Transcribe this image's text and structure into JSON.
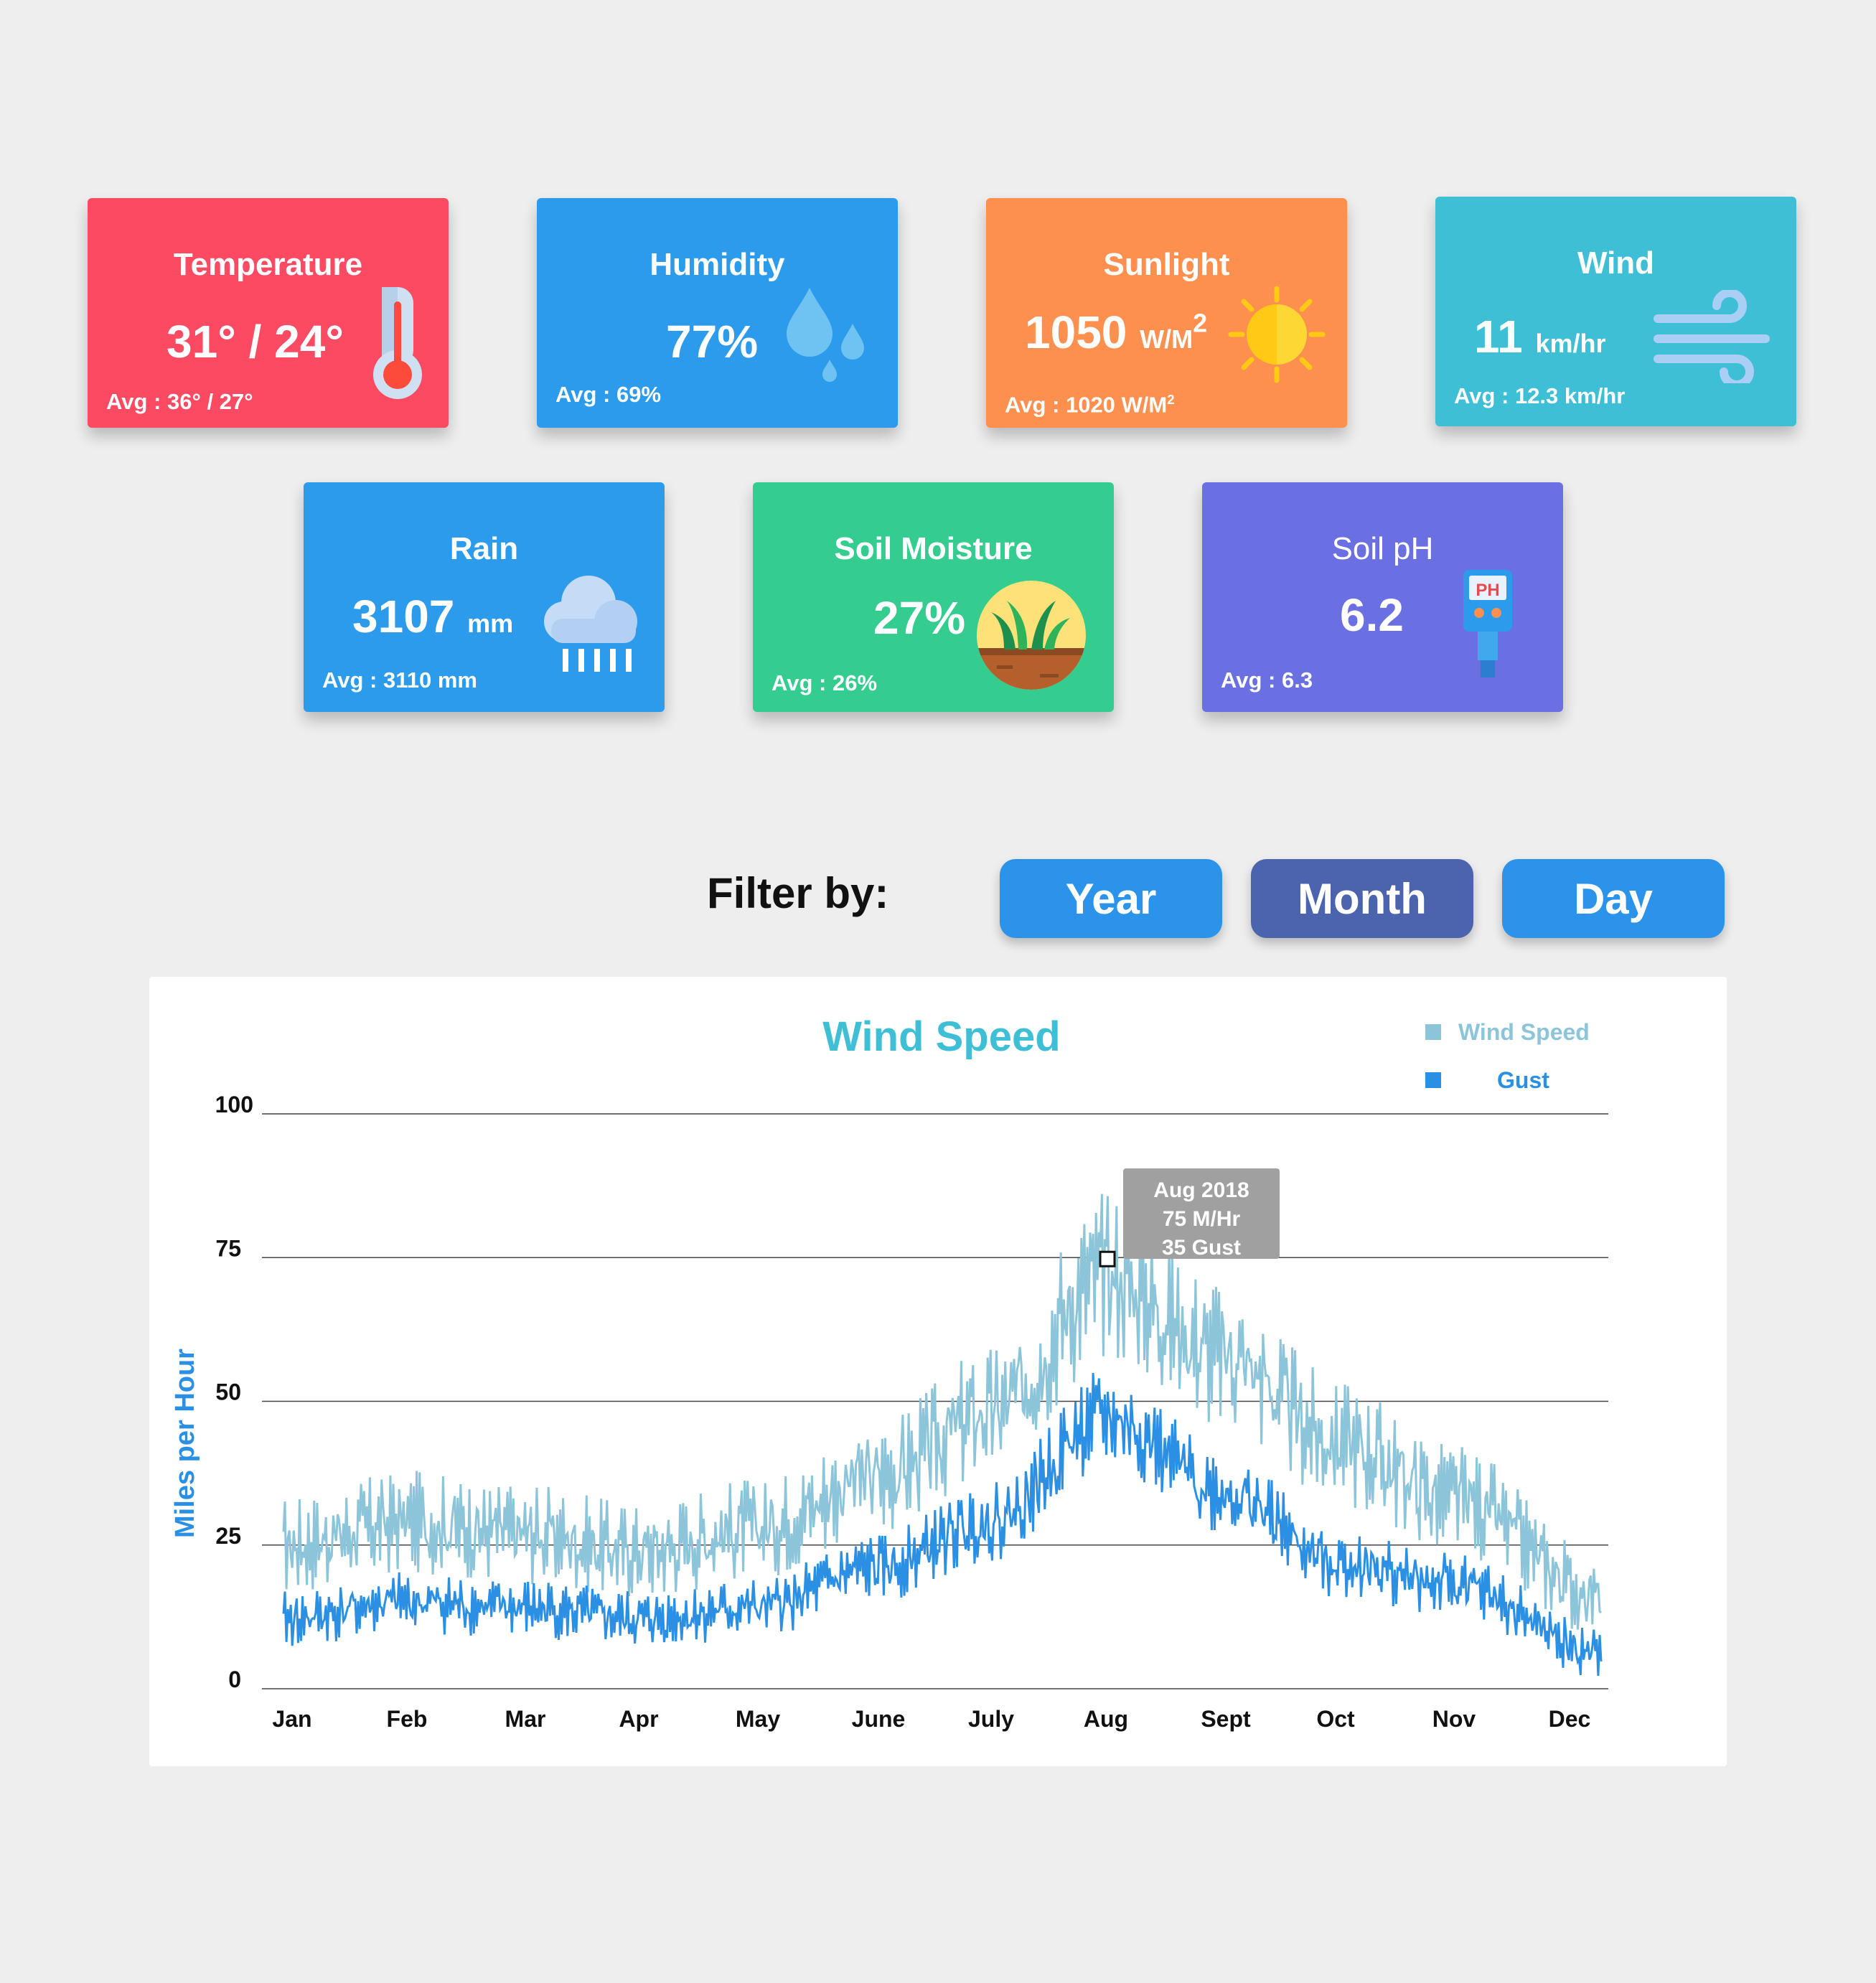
{
  "colors": {
    "temperature": "#fc4a63",
    "humidity": "#2c9bec",
    "sunlight": "#fd904f",
    "wind": "#3fbfd6",
    "rain": "#2c9bec",
    "soil_moisture": "#35cc8f",
    "soil_ph": "#6a70e2",
    "wind_speed": "#8cc5d9",
    "gust": "#2b8fe3",
    "btn_active": "#4c63ad",
    "btn": "#2c93ea"
  },
  "cards": {
    "temperature": {
      "title": "Temperature",
      "value": "31° / 24°",
      "avg": "Avg : 36° / 27°",
      "icon": "thermometer-icon"
    },
    "humidity": {
      "title": "Humidity",
      "value": "77%",
      "avg": "Avg : 69%",
      "icon": "water-drops-icon"
    },
    "sunlight": {
      "title": "Sunlight",
      "value": "1050",
      "unit": "W/M",
      "sup": "2",
      "avg_prefix": "Avg :  1020 W/M",
      "avg_sup": "2",
      "icon": "sun-icon"
    },
    "wind": {
      "title": "Wind",
      "value": "11",
      "unit": "km/hr",
      "avg": "Avg : 12.3 km/hr",
      "icon": "wind-icon"
    },
    "rain": {
      "title": "Rain",
      "value": "3107",
      "unit": "mm",
      "avg": "Avg : 3110 mm",
      "icon": "rain-cloud-icon"
    },
    "soil_moisture": {
      "title": "Soil Moisture",
      "value": "27%",
      "avg": "Avg : 26%",
      "icon": "grass-soil-icon"
    },
    "soil_ph": {
      "title": "Soil pH",
      "value": "6.2",
      "avg": "Avg : 6.3",
      "icon": "ph-meter-icon",
      "icon_text": "PH"
    }
  },
  "filter": {
    "label": "Filter by:",
    "buttons": [
      {
        "label": "Year",
        "active": false
      },
      {
        "label": "Month",
        "active": true
      },
      {
        "label": "Day",
        "active": false
      }
    ]
  },
  "chart_data": {
    "type": "line",
    "title": "Wind Speed",
    "xlabel": "",
    "ylabel": "Miles per Hour",
    "ylim": [
      0,
      100
    ],
    "yticks": [
      0,
      25,
      50,
      75,
      100
    ],
    "categories": [
      "Jan",
      "Feb",
      "Mar",
      "Apr",
      "May",
      "June",
      "July",
      "Aug",
      "Sept",
      "Oct",
      "Nov",
      "Dec"
    ],
    "grid": true,
    "legend_position": "top-right",
    "series": [
      {
        "name": "Wind Speed",
        "values": [
          25,
          29,
          27,
          24,
          28,
          37,
          48,
          72,
          58,
          43,
          33,
          16
        ]
      },
      {
        "name": "Gust",
        "values": [
          12,
          15,
          14,
          12,
          14,
          21,
          29,
          47,
          34,
          22,
          18,
          6
        ]
      }
    ],
    "tooltip": {
      "lines": [
        "Aug 2018",
        "75 M/Hr",
        "35 Gust"
      ],
      "x_index": 7,
      "y_value": 75
    }
  }
}
